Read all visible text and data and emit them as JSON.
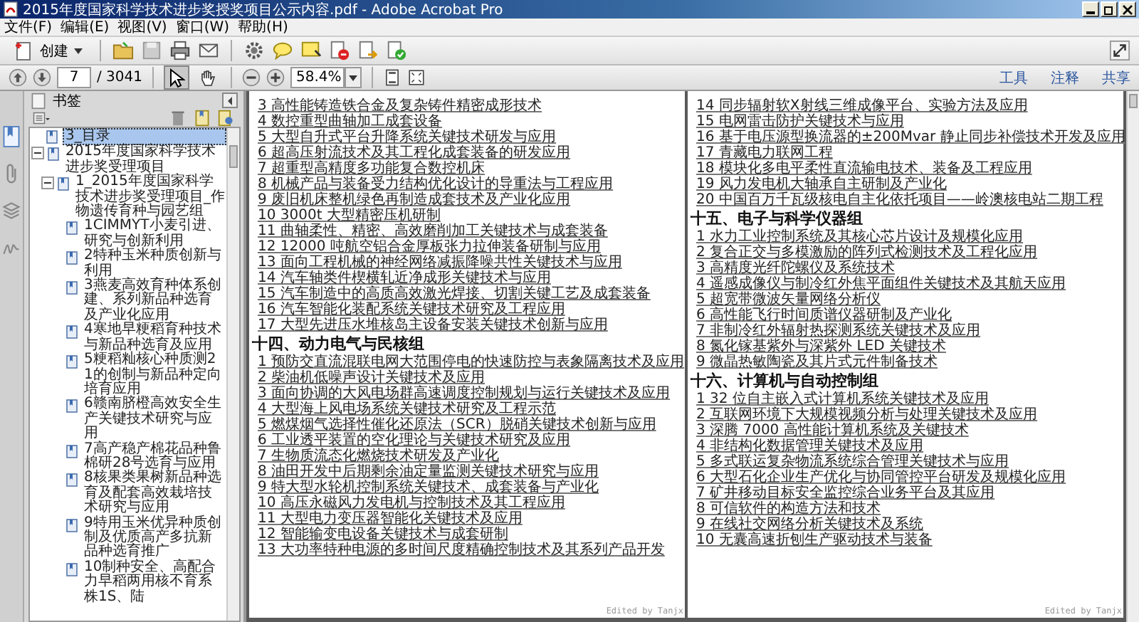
{
  "window": {
    "title": "2015年度国家科学技术进步奖授奖项目公示内容.pdf - Adobe Acrobat Pro"
  },
  "menu": [
    "文件(F)",
    "编辑(E)",
    "视图(V)",
    "窗口(W)",
    "帮助(H)"
  ],
  "toolbar": {
    "create": "创建",
    "page_number": "7",
    "page_total": "/ 3041",
    "zoom": "58.4%"
  },
  "tools": [
    {
      "kind": "select",
      "selected": true
    },
    {
      "kind": "hand",
      "selected": false
    }
  ],
  "panels": [
    "工具",
    "注释",
    "共享"
  ],
  "sidebar": {
    "title": "书签",
    "bookmarks": [
      {
        "label": "3_目录",
        "selected": true
      },
      {
        "label": "2015年度国家科学技术进步奖受理项目",
        "selected": false,
        "expanded": true,
        "children": [
          {
            "label": "1_2015年度国家科学技术进步奖受理项目_作物遗传育种与园艺组",
            "selected": false,
            "expanded": true,
            "children": [
              {
                "label": "1CIMMYT小麦引进、研究与创新利用",
                "selected": false
              },
              {
                "label": "2特种玉米种质创新与利用",
                "selected": false
              },
              {
                "label": "3燕麦高效育种体系创建、系列新品种选育及产业化应用",
                "selected": false
              },
              {
                "label": "4寒地早粳稻育种技术与新品种选育及应用",
                "selected": false
              },
              {
                "label": "5粳稻籼核心种质测21的创制与新品种定向培育应用",
                "selected": false
              },
              {
                "label": "6赣南脐橙高效安全生产关键技术研究与应用",
                "selected": false
              },
              {
                "label": "7高产稳产棉花品种鲁棉研28号选育与应用",
                "selected": false
              },
              {
                "label": "8核果类果树新品种选育及配套高效栽培技术研究与应用",
                "selected": false
              },
              {
                "label": "9特用玉米优异种质创制及优质高产多抗新品种选育推广",
                "selected": false
              },
              {
                "label": "10制种安全、高配合力早稻两用核不育系株1S、陆",
                "selected": false
              }
            ]
          }
        ]
      }
    ]
  },
  "pages": [
    {
      "sections": [
        {
          "items": [
            "3 高性能铸造铁合金及复杂铸件精密成形技术",
            "4 数控重型曲轴加工成套设备",
            "5 大型自升式平台升降系统关键技术研发与应用",
            "6 超高压射流技术及其工程化成套装备的研发应用",
            "7 超重型高精度多功能复合数控机床",
            "8 机械产品与装备受力结构优化设计的导重法与工程应用",
            "9 废旧机床整机绿色再制造成套技术及产业化应用",
            "10 3000t 大型精密压机研制",
            "11 曲轴柔性、精密、高效磨削加工关键技术与成套装备",
            "12 12000 吨航空铝合金厚板张力拉伸装备研制与应用",
            "13 面向工程机械的神经网络减振降噪共性关键技术与应用",
            "14 汽车轴类件楔横轧近净成形关键技术与应用",
            "15 汽车制造中的高质高效激光焊接、切割关键工艺及成套装备",
            "16 汽车智能化装配系统关键技术研究及工程应用",
            "17 大型先进压水堆核岛主设备安装关键技术创新与应用"
          ]
        },
        {
          "heading": "十四、动力电气与民核组",
          "items": [
            "1 预防交直流混联电网大范围停电的快速防控与表象隔离技术及应用",
            "2 柴油机低噪声设计关键技术及应用",
            "3 面向协调的大风电场群高速调度控制规划与运行关键技术及应用",
            "4 大型海上风电场系统关键技术研究及工程示范",
            "5 燃煤烟气选择性催化还原法（SCR）脱硝关键技术创新与应用",
            "6 工业透平装置的空化理论与关键技术研究及应用",
            "7 生物质流态化燃烧技术研发及产业化",
            "8 油田开发中后期剩余油定量监测关键技术研究与应用",
            "9 特大型水轮机控制系统关键技术、成套装备与产业化",
            "10 高压永磁风力发电机与控制技术及其工程应用",
            "11 大型电力变压器智能化关键技术及应用",
            "12 智能输变电设备关键技术与成套研制",
            "13 大功率特种电源的多时间尺度精确控制技术及其系列产品开发"
          ]
        }
      ],
      "footer": "Edited by Tanjx"
    },
    {
      "sections": [
        {
          "items": [
            "14 同步辐射软X射线三维成像平台、实验方法及应用",
            "15 电网雷击防护关键技术与应用",
            "16 基于电压源型换流器的±200Mvar 静止同步补偿技术开发及应用",
            "17 青藏电力联网工程",
            "18 模块化多电平柔性直流输电技术、装备及工程应用",
            "19 风力发电机大轴承自主研制及产业化",
            "20 中国百万千瓦级核电自主化依托项目——岭澳核电站二期工程"
          ]
        },
        {
          "heading": "十五、电子与科学仪器组",
          "items": [
            "1 水力工业控制系统及其核心芯片设计及规模化应用",
            "2 复合正交与多模激励的阵列式检测技术及工程化应用",
            "3 高精度光纤陀螺仪及系统技术",
            "4 遥感成像仪与制冷红外焦平面组件关键技术及其航天应用",
            "5 超宽带微波矢量网络分析仪",
            "6 高性能飞行时间质谱仪器研制及产业化",
            "7 非制冷红外辐射热探测系统关键技术及应用",
            "8 氮化镓基紫外与深紫外 LED 关键技术",
            "9 微晶热敏陶瓷及其片式元件制备技术"
          ]
        },
        {
          "heading": "十六、计算机与自动控制组",
          "items": [
            "1 32 位自主嵌入式计算机系统关键技术及应用",
            "2 互联网环境下大规模视频分析与处理关键技术及应用",
            "3 深腾 7000 高性能计算机系统及关键技术",
            "4 非结构化数据管理关键技术及应用",
            "5 多式联运复杂物流系统综合管理关键技术与应用",
            "6 大型石化企业生产优化与协同管控平台研发及规模化应用",
            "7 矿井移动目标安全监控综合业务平台及其应用",
            "8 可信软件的构造方法和技术",
            "9 在线社交网络分析关键技术及系统",
            "10 无囊高速折刨生产驱动技术与装备"
          ]
        }
      ],
      "footer": "Edited by Tanjx"
    }
  ]
}
